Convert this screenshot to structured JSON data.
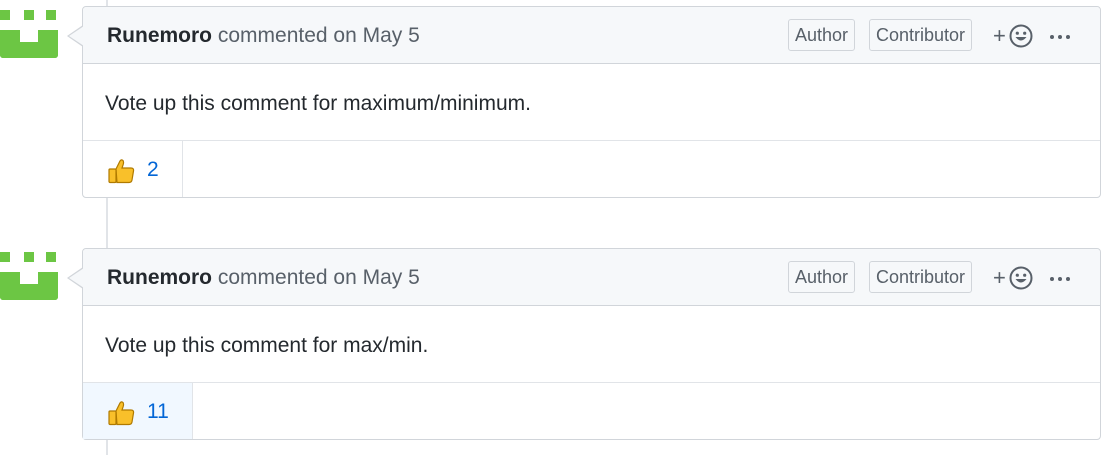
{
  "comments": [
    {
      "author": "Runemoro",
      "meta": "commented on May 5",
      "labels": {
        "author": "Author",
        "contributor": "Contributor"
      },
      "react_plus": "+",
      "body": "Vote up this comment for maximum/minimum.",
      "reaction": {
        "emoji": "thumbs-up",
        "count": "2",
        "active": false
      }
    },
    {
      "author": "Runemoro",
      "meta": "commented on May 5",
      "labels": {
        "author": "Author",
        "contributor": "Contributor"
      },
      "react_plus": "+",
      "body": "Vote up this comment for max/min.",
      "reaction": {
        "emoji": "thumbs-up",
        "count": "11",
        "active": true
      }
    }
  ],
  "colors": {
    "avatar_green": "#6cc644",
    "link_blue": "#0366d6",
    "active_reaction_bg": "#f1f8ff"
  }
}
